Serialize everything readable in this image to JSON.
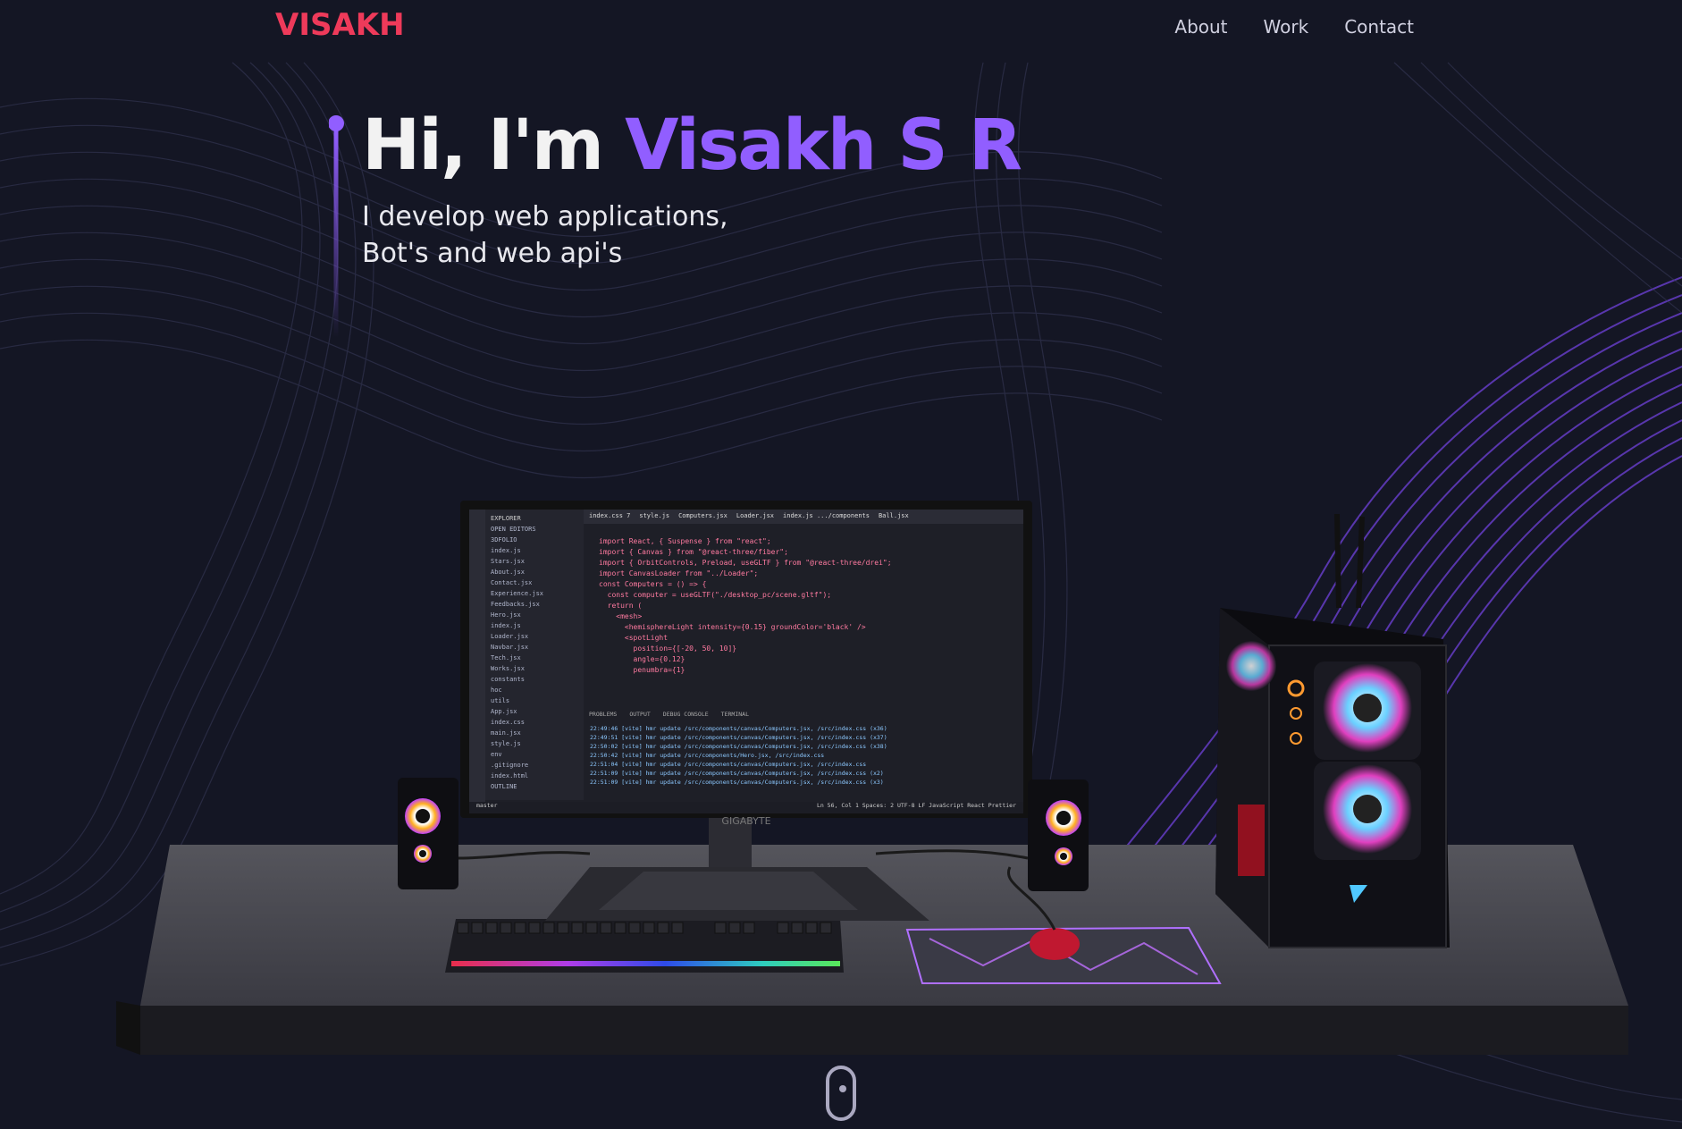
{
  "brand": {
    "logo": "VISAKH",
    "color": "#ee3a5a"
  },
  "nav": {
    "links": [
      {
        "label": "About"
      },
      {
        "label": "Work"
      },
      {
        "label": "Contact"
      }
    ]
  },
  "hero": {
    "greeting": "Hi, I'm ",
    "name": "Visakh S R",
    "subtitle_line1": "I develop web applications,",
    "subtitle_line2": "Bot's and web api's",
    "accent": "#915eff"
  },
  "scene": {
    "monitor_brand": "GIGABYTE",
    "editor": {
      "tabs": [
        "index.css 7",
        "style.js",
        "Computers.jsx",
        "Loader.jsx",
        "index.js .../components",
        "Ball.jsx"
      ],
      "sidebar_header": "EXPLORER",
      "sidebar_items": [
        "OPEN EDITORS",
        "3DFOLIO",
        "index.js",
        "Stars.jsx",
        "About.jsx",
        "Contact.jsx",
        "Experience.jsx",
        "Feedbacks.jsx",
        "Hero.jsx",
        "index.js",
        "Loader.jsx",
        "Navbar.jsx",
        "Tech.jsx",
        "Works.jsx",
        "constants",
        "hoc",
        "utils",
        "App.jsx",
        "index.css",
        "main.jsx",
        "style.js",
        "env",
        ".gitignore",
        "index.html",
        "OUTLINE"
      ],
      "code_lines": [
        "import React, { Suspense } from \"react\";",
        "import { Canvas } from \"@react-three/fiber\";",
        "import { OrbitControls, Preload, useGLTF } from \"@react-three/drei\";",
        "",
        "import CanvasLoader from \"../Loader\";",
        "",
        "const Computers = () => {",
        "  const computer = useGLTF(\"./desktop_pc/scene.gltf\");",
        "",
        "  return (",
        "    <mesh>",
        "      <hemisphereLight intensity={0.15} groundColor='black' />",
        "      <spotLight",
        "        position={[-20, 50, 10]}",
        "        angle={0.12}",
        "        penumbra={1}"
      ],
      "panel_tabs": [
        "PROBLEMS",
        "OUTPUT",
        "DEBUG CONSOLE",
        "TERMINAL"
      ],
      "terminal_lines": [
        "22:49:46 [vite] hmr update /src/components/canvas/Computers.jsx, /src/index.css (x36)",
        "22:49:51 [vite] hmr update /src/components/canvas/Computers.jsx, /src/index.css (x37)",
        "22:50:02 [vite] hmr update /src/components/canvas/Computers.jsx, /src/index.css (x38)",
        "22:50:42 [vite] hmr update /src/components/Hero.jsx, /src/index.css",
        "22:51:04 [vite] hmr update /src/components/canvas/Computers.jsx, /src/index.css",
        "22:51:09 [vite] hmr update /src/components/canvas/Computers.jsx, /src/index.css (x2)",
        "22:51:09 [vite] hmr update /src/components/canvas/Computers.jsx, /src/index.css (x3)"
      ],
      "status_left": "master",
      "status_right": "Ln 56, Col 1   Spaces: 2   UTF-8   LF   JavaScript React   Prettier"
    }
  }
}
